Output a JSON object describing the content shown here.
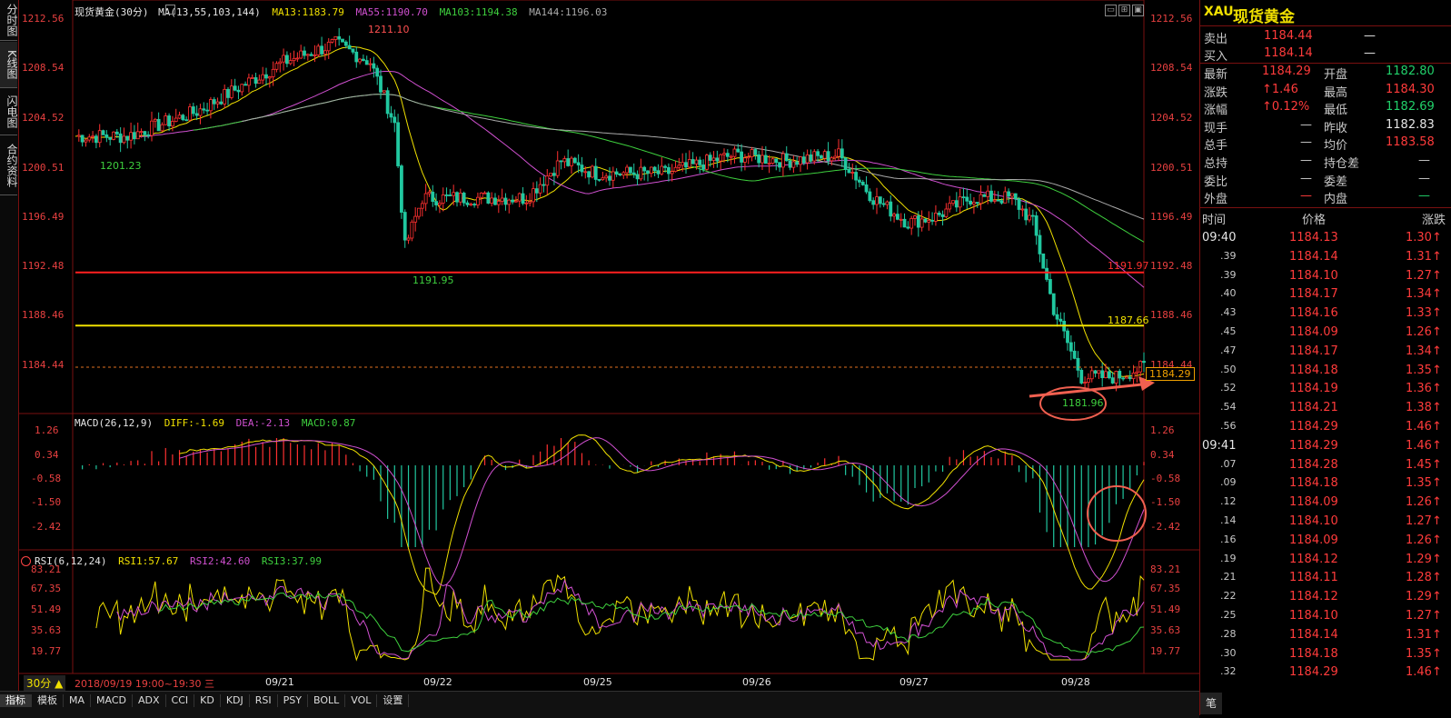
{
  "left_nav": [
    "分时图",
    "K线图",
    "闪电图",
    "合约资料"
  ],
  "main_chart": {
    "title": "现货黄金(30分)",
    "ma_label": "MA(13,55,103,144)",
    "ma13": "MA13:1183.79",
    "ma55": "MA55:1190.70",
    "ma103": "MA103:1194.38",
    "ma144": "MA144:1196.03",
    "y_ticks": [
      "1212.56",
      "1208.54",
      "1204.52",
      "1200.51",
      "1196.49",
      "1192.48",
      "1188.46",
      "1184.44"
    ],
    "annotations": {
      "high": "1211.10",
      "low1": "1201.23",
      "low2": "1191.95",
      "low3": "1181.96",
      "red_line": "1191.97",
      "yellow_line": "1187.66",
      "current": "1184.29"
    }
  },
  "macd": {
    "title": "MACD(26,12,9)",
    "diff": "DIFF:-1.69",
    "dea": "DEA:-2.13",
    "macd": "MACD:0.87",
    "y_ticks": [
      "1.26",
      "0.34",
      "-0.58",
      "-1.50",
      "-2.42"
    ]
  },
  "rsi": {
    "title": "RSI(6,12,24)",
    "rsi1": "RSI1:57.67",
    "rsi2": "RSI2:42.60",
    "rsi3": "RSI3:37.99",
    "y_ticks": [
      "83.21",
      "67.35",
      "51.49",
      "35.63",
      "19.77"
    ]
  },
  "x_axis": {
    "period": "30分",
    "cursor_time": "2018/09/19 19:00~19:30 三",
    "dates": [
      "09/21",
      "09/22",
      "09/25",
      "09/26",
      "09/27",
      "09/28"
    ]
  },
  "tabs": [
    "指标",
    "模板",
    "MA",
    "MACD",
    "ADX",
    "CCI",
    "KD",
    "KDJ",
    "RSI",
    "PSY",
    "BOLL",
    "VOL",
    "设置"
  ],
  "quote": {
    "code": "XAU",
    "name": "现货黄金",
    "sell_label": "卖出",
    "sell": "1184.44",
    "sell_vol": "—",
    "buy_label": "买入",
    "buy": "1184.14",
    "buy_vol": "—",
    "rows": [
      {
        "l1": "最新",
        "v1": "1184.29",
        "c1": "red",
        "l2": "开盘",
        "v2": "1182.80",
        "c2": "green"
      },
      {
        "l1": "涨跌",
        "v1": "↑1.46",
        "c1": "red",
        "l2": "最高",
        "v2": "1184.30",
        "c2": "red"
      },
      {
        "l1": "涨幅",
        "v1": "↑0.12%",
        "c1": "red",
        "l2": "最低",
        "v2": "1182.69",
        "c2": "green"
      },
      {
        "l1": "现手",
        "v1": "—",
        "c1": "gray",
        "l2": "昨收",
        "v2": "1182.83",
        "c2": "white"
      },
      {
        "l1": "总手",
        "v1": "—",
        "c1": "gray",
        "l2": "均价",
        "v2": "1183.58",
        "c2": "red"
      },
      {
        "l1": "总持",
        "v1": "—",
        "c1": "gray",
        "l2": "持仓差",
        "v2": "—",
        "c2": "gray"
      },
      {
        "l1": "委比",
        "v1": "—",
        "c1": "gray",
        "l2": "委差",
        "v2": "—",
        "c2": "gray"
      },
      {
        "l1": "外盘",
        "v1": "—",
        "c1": "red",
        "l2": "内盘",
        "v2": "—",
        "c2": "green"
      }
    ],
    "tick_headers": [
      "时间",
      "价格",
      "涨跌"
    ],
    "ticks": [
      {
        "t": "09:40",
        "p": "1184.13",
        "c": "1.30↑"
      },
      {
        "t": ".39",
        "p": "1184.14",
        "c": "1.31↑"
      },
      {
        "t": ".39",
        "p": "1184.10",
        "c": "1.27↑"
      },
      {
        "t": ".40",
        "p": "1184.17",
        "c": "1.34↑"
      },
      {
        "t": ".43",
        "p": "1184.16",
        "c": "1.33↑"
      },
      {
        "t": ".45",
        "p": "1184.09",
        "c": "1.26↑"
      },
      {
        "t": ".47",
        "p": "1184.17",
        "c": "1.34↑"
      },
      {
        "t": ".50",
        "p": "1184.18",
        "c": "1.35↑"
      },
      {
        "t": ".52",
        "p": "1184.19",
        "c": "1.36↑"
      },
      {
        "t": ".54",
        "p": "1184.21",
        "c": "1.38↑"
      },
      {
        "t": ".56",
        "p": "1184.29",
        "c": "1.46↑"
      },
      {
        "t": "09:41",
        "p": "1184.29",
        "c": "1.46↑"
      },
      {
        "t": ".07",
        "p": "1184.28",
        "c": "1.45↑"
      },
      {
        "t": ".09",
        "p": "1184.18",
        "c": "1.35↑"
      },
      {
        "t": ".12",
        "p": "1184.09",
        "c": "1.26↑"
      },
      {
        "t": ".14",
        "p": "1184.10",
        "c": "1.27↑"
      },
      {
        "t": ".16",
        "p": "1184.09",
        "c": "1.26↑"
      },
      {
        "t": ".19",
        "p": "1184.12",
        "c": "1.29↑"
      },
      {
        "t": ".21",
        "p": "1184.11",
        "c": "1.28↑"
      },
      {
        "t": ".22",
        "p": "1184.12",
        "c": "1.29↑"
      },
      {
        "t": ".25",
        "p": "1184.10",
        "c": "1.27↑"
      },
      {
        "t": ".28",
        "p": "1184.14",
        "c": "1.31↑"
      },
      {
        "t": ".30",
        "p": "1184.18",
        "c": "1.35↑"
      },
      {
        "t": ".32",
        "p": "1184.29",
        "c": "1.46↑"
      }
    ],
    "footer": "笔"
  }
}
